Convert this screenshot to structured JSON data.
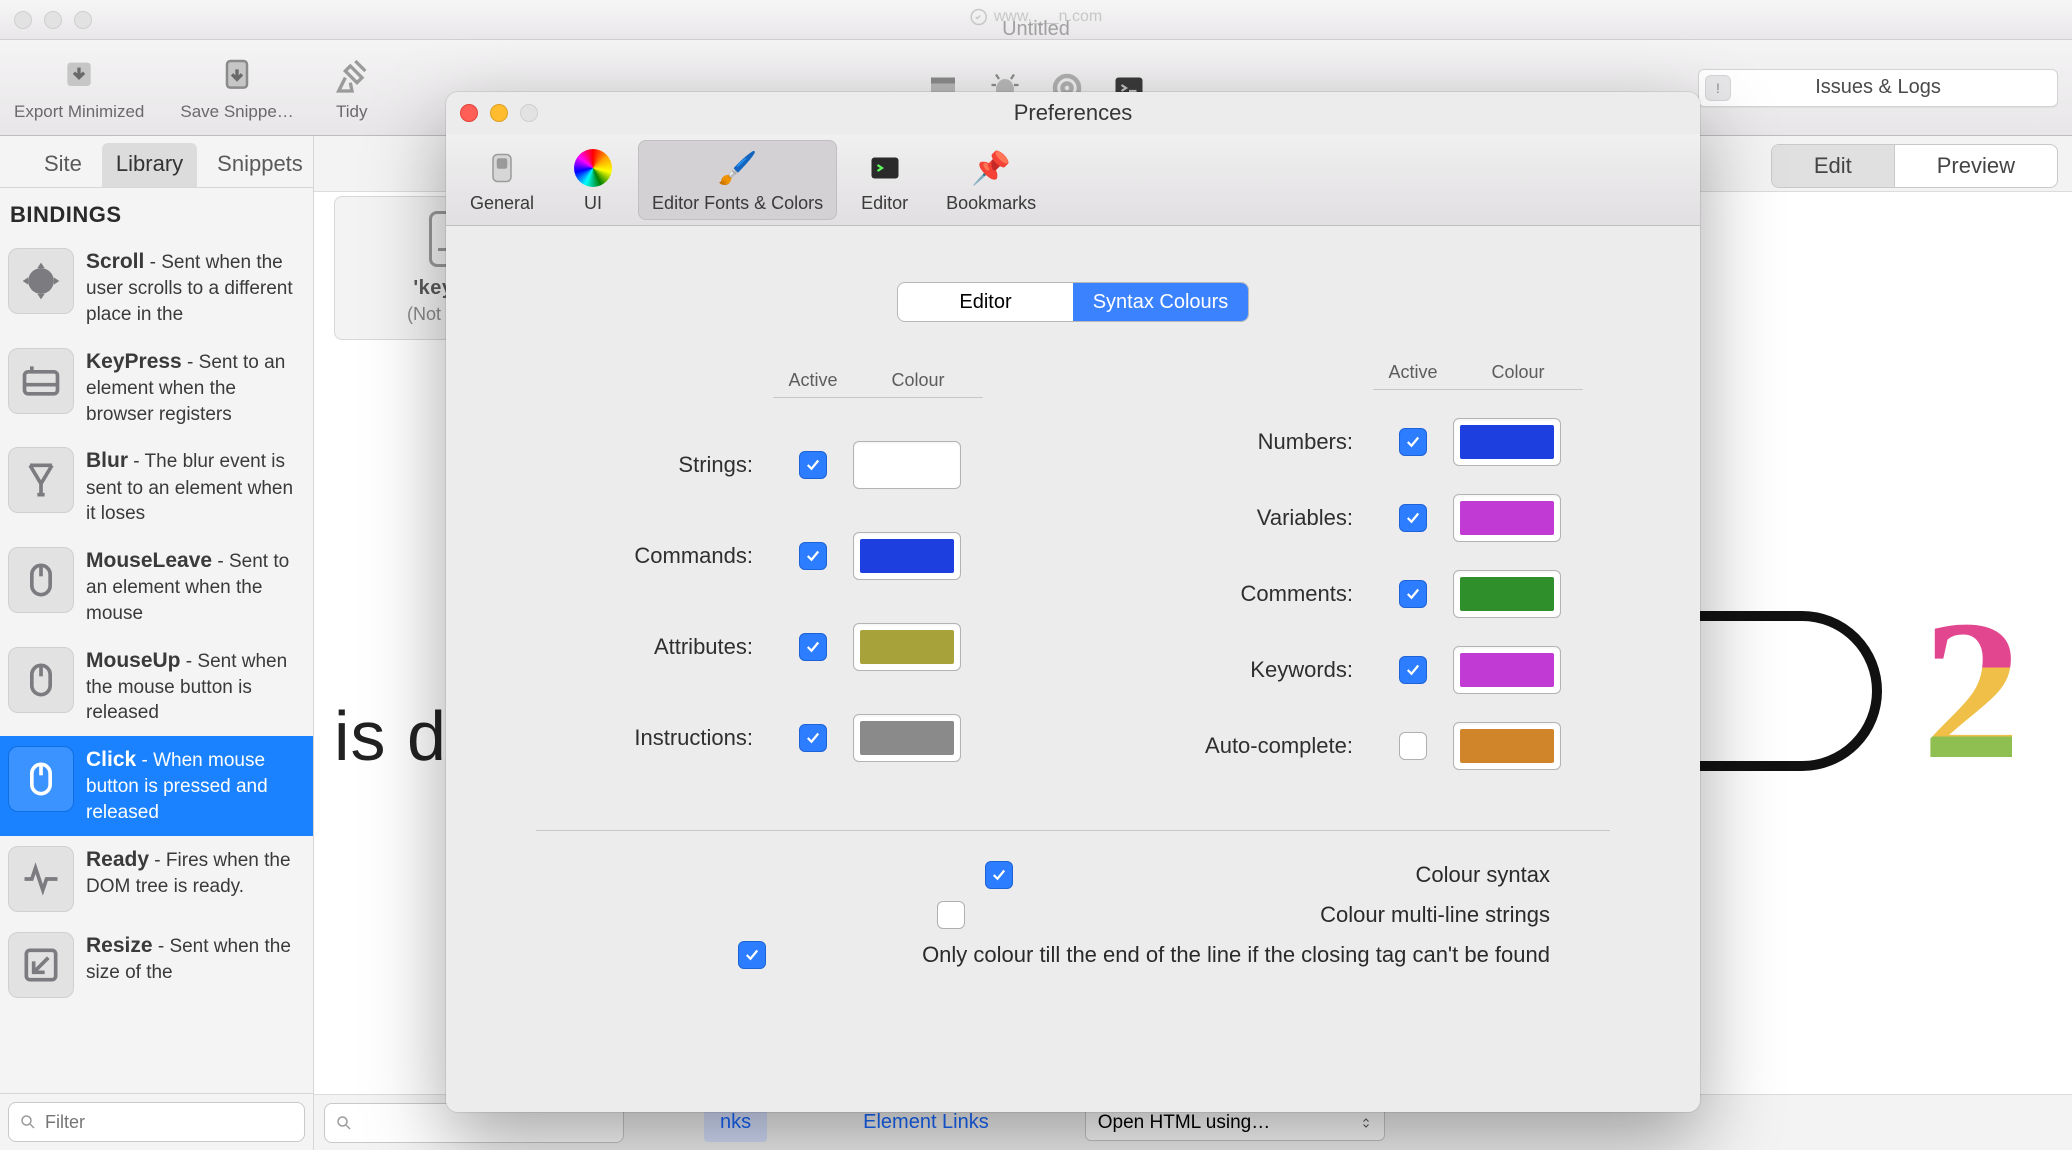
{
  "main_window": {
    "title": "Untitled",
    "watermark": "www.___n.com",
    "toolbar": {
      "export_minimized": "Export Minimized",
      "save_snippet": "Save Snippe…",
      "tidy": "Tidy",
      "issues_logs": "Issues & Logs"
    },
    "view_toggle": {
      "edit": "Edit",
      "preview": "Preview"
    },
    "keypress_card": {
      "title": "'keypress'",
      "subtitle": "(Not attached)"
    },
    "bottom": {
      "link2": "Element Links",
      "select": "Open HTML using…",
      "links_partial": "nks"
    }
  },
  "sidebar": {
    "tabs": {
      "site": "Site",
      "library": "Library",
      "snippets": "Snippets"
    },
    "group_title": "BINDINGS",
    "filter_placeholder": "Filter",
    "items": [
      {
        "title": "Scroll",
        "desc": "Sent when the user scrolls to a different place in the"
      },
      {
        "title": "KeyPress",
        "desc": "Sent to an element when the browser registers"
      },
      {
        "title": "Blur",
        "desc": "The blur event is sent to an element when it loses"
      },
      {
        "title": "MouseLeave",
        "desc": "Sent to an element when the mouse"
      },
      {
        "title": "MouseUp",
        "desc": "Sent when the mouse button is released"
      },
      {
        "title": "Click",
        "desc": "When mouse button is pressed and released"
      },
      {
        "title": "Ready",
        "desc": "Fires when the DOM tree is ready."
      },
      {
        "title": "Resize",
        "desc": "Sent when the size of the"
      }
    ]
  },
  "prefs": {
    "window_title": "Preferences",
    "tabs": {
      "general": "General",
      "ui": "UI",
      "fonts": "Editor Fonts & Colors",
      "editor": "Editor",
      "bookmarks": "Bookmarks"
    },
    "seg": {
      "editor": "Editor",
      "syntax": "Syntax Colours"
    },
    "headers": {
      "active": "Active",
      "colour": "Colour"
    },
    "left_rows": [
      {
        "label": "Strings:",
        "active": true,
        "color": "#c23a2d"
      },
      {
        "label": "Commands:",
        "active": true,
        "color": "#1e3fe0"
      },
      {
        "label": "Attributes:",
        "active": true,
        "color": "#a8a23a"
      },
      {
        "label": "Instructions:",
        "active": true,
        "color": "#8a8a8a"
      }
    ],
    "right_rows": [
      {
        "label": "Numbers:",
        "active": true,
        "color": "#1e3fe0"
      },
      {
        "label": "Variables:",
        "active": true,
        "color": "#c23ad4"
      },
      {
        "label": "Comments:",
        "active": true,
        "color": "#2f8f2b"
      },
      {
        "label": "Keywords:",
        "active": true,
        "color": "#c23ad4"
      },
      {
        "label": "Auto-complete:",
        "active": false,
        "color": "#d0852b"
      }
    ],
    "options": {
      "colour_syntax": {
        "label": "Colour syntax",
        "checked": true
      },
      "multi_line": {
        "label": "Colour multi-line strings",
        "checked": false
      },
      "till_end": {
        "label": "Only colour till the end of the line if the closing tag can't be found",
        "checked": true
      }
    }
  }
}
